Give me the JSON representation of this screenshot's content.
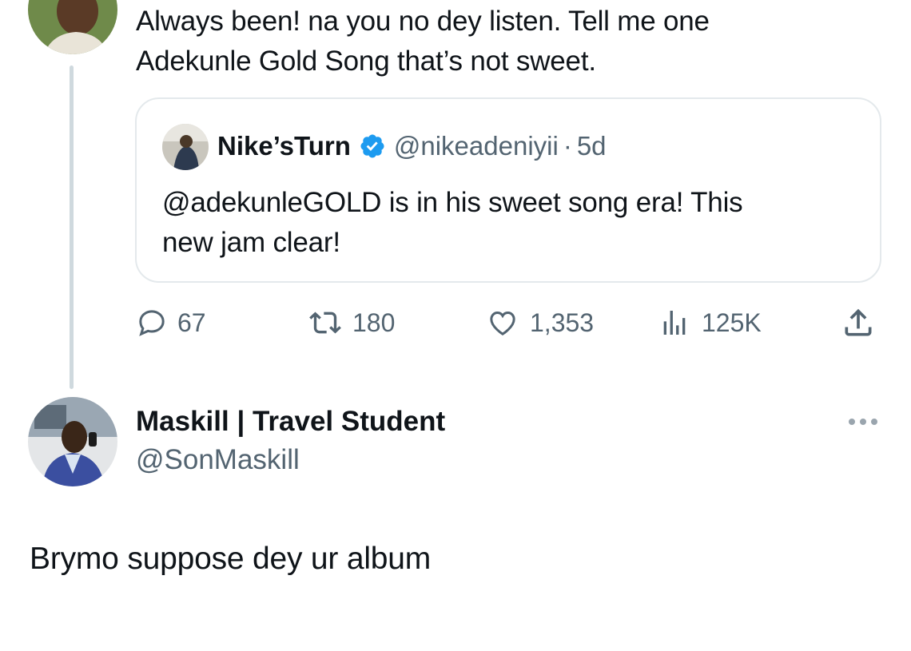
{
  "parent_tweet": {
    "text_lines": [
      "Always been! na you no dey listen. Tell me one",
      "Adekunle Gold Song that’s not sweet."
    ],
    "quote": {
      "name": "Nike’sTurn",
      "handle": "@nikeadeniyii",
      "separator": "·",
      "time": "5d",
      "text_lines": [
        "@adekunleGOLD is in his sweet song era! This",
        "new jam clear!"
      ]
    },
    "actions": {
      "replies": "67",
      "reposts": "180",
      "likes": "1,353",
      "views": "125K"
    }
  },
  "reply": {
    "name": "Maskill | Travel Student",
    "handle": "@SonMaskill",
    "text": "Brymo suppose dey ur album"
  },
  "colors": {
    "text": "#0f1419",
    "muted": "#536471",
    "verified": "#1d9bf0",
    "border": "#e4e9ec",
    "thread_line": "#cfd9de"
  },
  "icons": [
    "reply-icon",
    "repost-icon",
    "like-icon",
    "views-icon",
    "share-icon",
    "verified-badge-icon",
    "more-options-icon"
  ]
}
